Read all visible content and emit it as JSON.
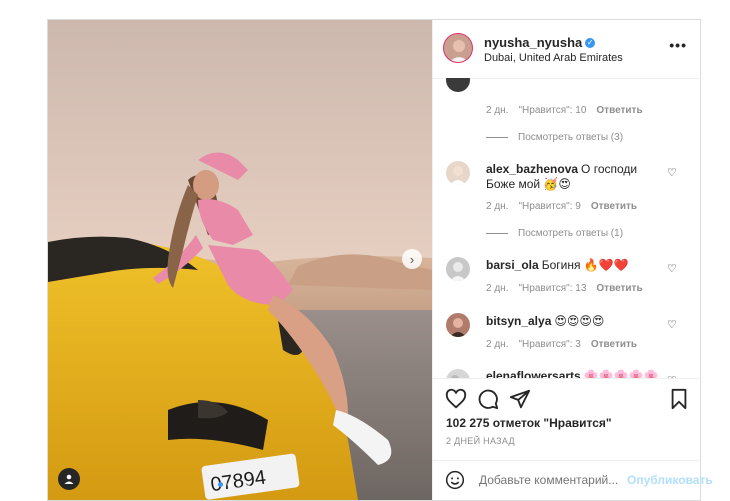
{
  "header": {
    "username": "nyusha_nyusha",
    "location": "Dubai, United Arab Emirates",
    "more": "•••"
  },
  "comments": [
    {
      "time": "2 дн.",
      "likes": "\"Нравится\": 10",
      "reply": "Ответить",
      "view_replies": "Посмотреть ответы (3)"
    },
    {
      "user": "alex_bazhenova",
      "text": "О господи Боже мой 🥳😍",
      "time": "2 дн.",
      "likes": "\"Нравится\": 9",
      "reply": "Ответить",
      "view_replies": "Посмотреть ответы (1)"
    },
    {
      "user": "barsi_ola",
      "text": "Богиня 🔥❤️❤️",
      "time": "2 дн.",
      "likes": "\"Нравится\": 13",
      "reply": "Ответить"
    },
    {
      "user": "bitsyn_alya",
      "text": "😍😍😍😍",
      "time": "2 дн.",
      "likes": "\"Нравится\": 3",
      "reply": "Ответить"
    },
    {
      "user": "elenaflowersarts",
      "text": "🌸🌸🌸🌸🌸🌸🌸🌸"
    }
  ],
  "actions": {
    "likes": "102 275 отметок \"Нравится\"",
    "date": "2 ДНЕЙ НАЗАД"
  },
  "add_comment": {
    "placeholder": "Добавьте комментарий...",
    "publish": "Опубликовать"
  },
  "photo": {
    "plate": "07894",
    "carousel_count": 4,
    "carousel_active": 0
  },
  "colors": {
    "accent": "#3897f0",
    "car": "#e8b420",
    "sky": "#e9d4c8",
    "publish_disabled": "#b2dffc"
  }
}
